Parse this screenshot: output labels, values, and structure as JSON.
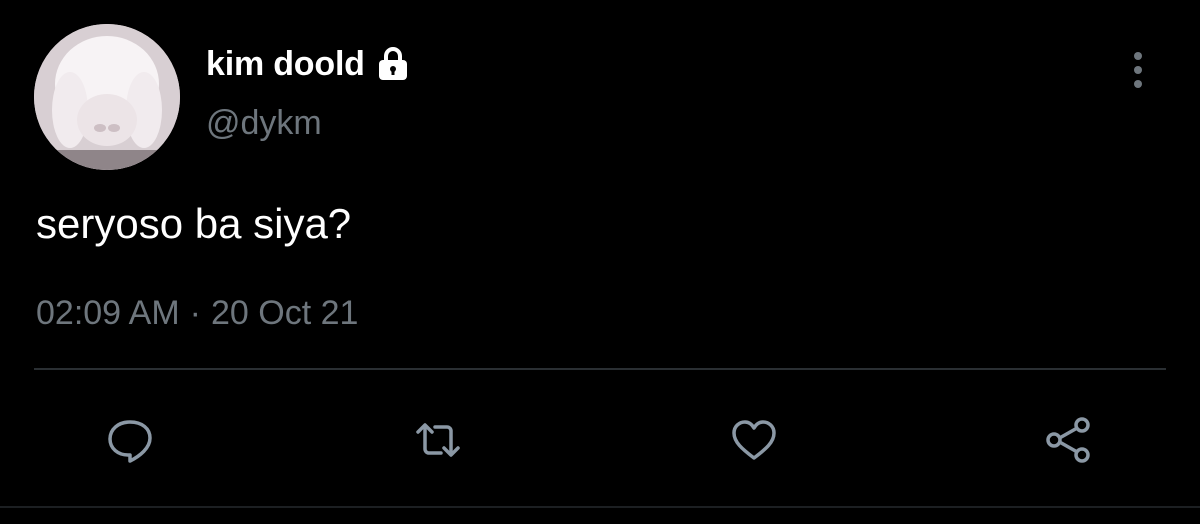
{
  "tweet": {
    "display_name": "kim doold",
    "handle": "@dykm",
    "text": "seryoso ba siya?",
    "time": "02:09 AM",
    "separator": "·",
    "date": "20 Oct 21",
    "protected_icon": "lock-icon",
    "avatar": "white-bunny-photo"
  },
  "actions": {
    "reply_icon": "speech-bubble-icon",
    "retweet_icon": "retweet-arrows-icon",
    "like_icon": "heart-icon",
    "share_icon": "share-nodes-icon",
    "more_icon": "vertical-ellipsis-icon"
  },
  "colors": {
    "background": "#000000",
    "primary_text": "#ffffff",
    "secondary_text": "#6e767d",
    "divider": "#2a2f33"
  }
}
